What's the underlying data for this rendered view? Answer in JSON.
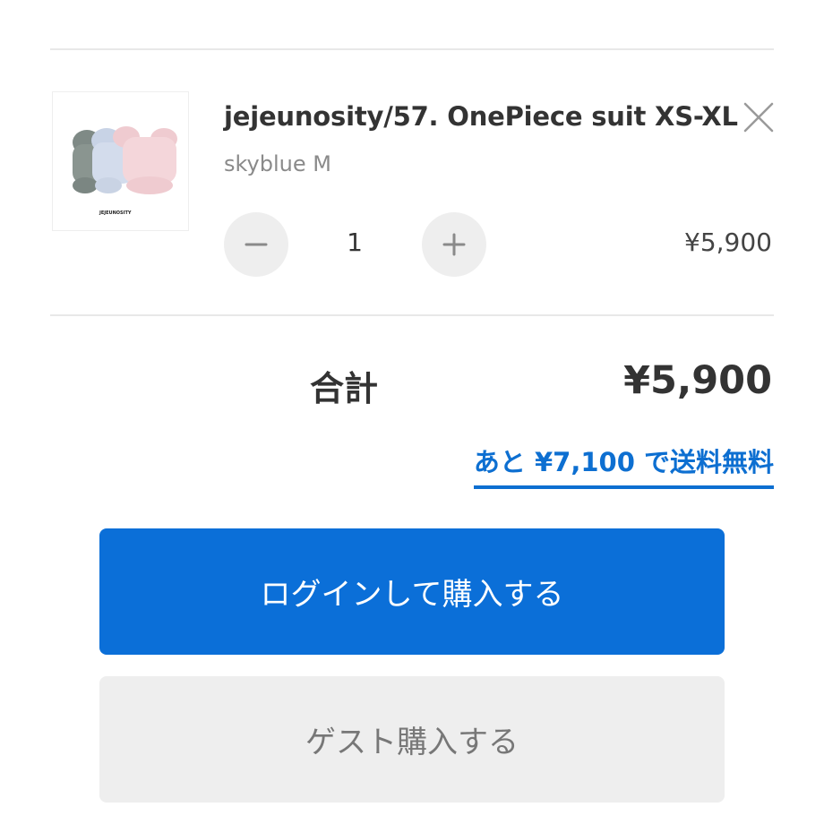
{
  "cart_item": {
    "product_name": "jejeunosity/57. OnePiece suit XS-XL",
    "variant": "skyblue M",
    "quantity": "1",
    "price": "¥5,900",
    "thumbnail_brand": "JEJEUNOSITY",
    "icons": {
      "close": "close-icon",
      "decrease": "minus-icon",
      "increase": "plus-icon"
    }
  },
  "summary": {
    "total_label": "合計",
    "total_value": "¥5,900",
    "free_shipping_message": "あと ¥7,100 で送料無料"
  },
  "actions": {
    "login_purchase_label": "ログインして購入する",
    "guest_purchase_label": "ゲスト購入する"
  },
  "colors": {
    "accent_blue": "#0b6fd8",
    "link_blue": "#0d6fd1",
    "button_gray": "#eeeeee",
    "divider": "#e8e8e8"
  }
}
